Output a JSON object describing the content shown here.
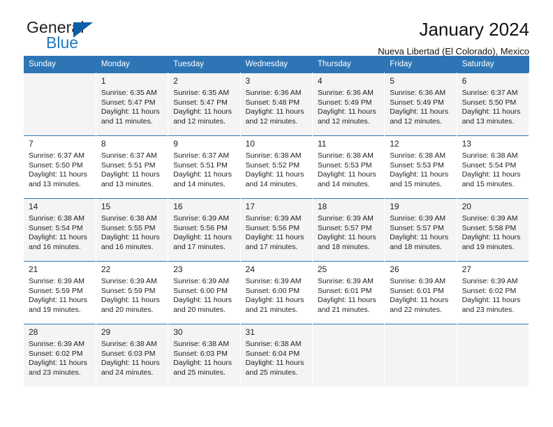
{
  "brand": {
    "name_top": "General",
    "name_bottom": "Blue",
    "triangle_color": "#0d5fa6",
    "blue_text_color": "#2179bf"
  },
  "header": {
    "title": "January 2024",
    "subtitle": "Nueva Libertad (El Colorado), Mexico"
  },
  "theme": {
    "header_bar_color": "#2e75b6",
    "shaded_row_color": "#f4f4f4",
    "text_color": "#222222"
  },
  "calendar": {
    "weekday_headers": [
      "Sunday",
      "Monday",
      "Tuesday",
      "Wednesday",
      "Thursday",
      "Friday",
      "Saturday"
    ],
    "weeks": [
      [
        {
          "day": "",
          "sunrise": "",
          "sunset": "",
          "daylight1": "",
          "daylight2": ""
        },
        {
          "day": "1",
          "sunrise": "Sunrise: 6:35 AM",
          "sunset": "Sunset: 5:47 PM",
          "daylight1": "Daylight: 11 hours",
          "daylight2": "and 11 minutes."
        },
        {
          "day": "2",
          "sunrise": "Sunrise: 6:35 AM",
          "sunset": "Sunset: 5:47 PM",
          "daylight1": "Daylight: 11 hours",
          "daylight2": "and 12 minutes."
        },
        {
          "day": "3",
          "sunrise": "Sunrise: 6:36 AM",
          "sunset": "Sunset: 5:48 PM",
          "daylight1": "Daylight: 11 hours",
          "daylight2": "and 12 minutes."
        },
        {
          "day": "4",
          "sunrise": "Sunrise: 6:36 AM",
          "sunset": "Sunset: 5:49 PM",
          "daylight1": "Daylight: 11 hours",
          "daylight2": "and 12 minutes."
        },
        {
          "day": "5",
          "sunrise": "Sunrise: 6:36 AM",
          "sunset": "Sunset: 5:49 PM",
          "daylight1": "Daylight: 11 hours",
          "daylight2": "and 12 minutes."
        },
        {
          "day": "6",
          "sunrise": "Sunrise: 6:37 AM",
          "sunset": "Sunset: 5:50 PM",
          "daylight1": "Daylight: 11 hours",
          "daylight2": "and 13 minutes."
        }
      ],
      [
        {
          "day": "7",
          "sunrise": "Sunrise: 6:37 AM",
          "sunset": "Sunset: 5:50 PM",
          "daylight1": "Daylight: 11 hours",
          "daylight2": "and 13 minutes."
        },
        {
          "day": "8",
          "sunrise": "Sunrise: 6:37 AM",
          "sunset": "Sunset: 5:51 PM",
          "daylight1": "Daylight: 11 hours",
          "daylight2": "and 13 minutes."
        },
        {
          "day": "9",
          "sunrise": "Sunrise: 6:37 AM",
          "sunset": "Sunset: 5:51 PM",
          "daylight1": "Daylight: 11 hours",
          "daylight2": "and 14 minutes."
        },
        {
          "day": "10",
          "sunrise": "Sunrise: 6:38 AM",
          "sunset": "Sunset: 5:52 PM",
          "daylight1": "Daylight: 11 hours",
          "daylight2": "and 14 minutes."
        },
        {
          "day": "11",
          "sunrise": "Sunrise: 6:38 AM",
          "sunset": "Sunset: 5:53 PM",
          "daylight1": "Daylight: 11 hours",
          "daylight2": "and 14 minutes."
        },
        {
          "day": "12",
          "sunrise": "Sunrise: 6:38 AM",
          "sunset": "Sunset: 5:53 PM",
          "daylight1": "Daylight: 11 hours",
          "daylight2": "and 15 minutes."
        },
        {
          "day": "13",
          "sunrise": "Sunrise: 6:38 AM",
          "sunset": "Sunset: 5:54 PM",
          "daylight1": "Daylight: 11 hours",
          "daylight2": "and 15 minutes."
        }
      ],
      [
        {
          "day": "14",
          "sunrise": "Sunrise: 6:38 AM",
          "sunset": "Sunset: 5:54 PM",
          "daylight1": "Daylight: 11 hours",
          "daylight2": "and 16 minutes."
        },
        {
          "day": "15",
          "sunrise": "Sunrise: 6:38 AM",
          "sunset": "Sunset: 5:55 PM",
          "daylight1": "Daylight: 11 hours",
          "daylight2": "and 16 minutes."
        },
        {
          "day": "16",
          "sunrise": "Sunrise: 6:39 AM",
          "sunset": "Sunset: 5:56 PM",
          "daylight1": "Daylight: 11 hours",
          "daylight2": "and 17 minutes."
        },
        {
          "day": "17",
          "sunrise": "Sunrise: 6:39 AM",
          "sunset": "Sunset: 5:56 PM",
          "daylight1": "Daylight: 11 hours",
          "daylight2": "and 17 minutes."
        },
        {
          "day": "18",
          "sunrise": "Sunrise: 6:39 AM",
          "sunset": "Sunset: 5:57 PM",
          "daylight1": "Daylight: 11 hours",
          "daylight2": "and 18 minutes."
        },
        {
          "day": "19",
          "sunrise": "Sunrise: 6:39 AM",
          "sunset": "Sunset: 5:57 PM",
          "daylight1": "Daylight: 11 hours",
          "daylight2": "and 18 minutes."
        },
        {
          "day": "20",
          "sunrise": "Sunrise: 6:39 AM",
          "sunset": "Sunset: 5:58 PM",
          "daylight1": "Daylight: 11 hours",
          "daylight2": "and 19 minutes."
        }
      ],
      [
        {
          "day": "21",
          "sunrise": "Sunrise: 6:39 AM",
          "sunset": "Sunset: 5:59 PM",
          "daylight1": "Daylight: 11 hours",
          "daylight2": "and 19 minutes."
        },
        {
          "day": "22",
          "sunrise": "Sunrise: 6:39 AM",
          "sunset": "Sunset: 5:59 PM",
          "daylight1": "Daylight: 11 hours",
          "daylight2": "and 20 minutes."
        },
        {
          "day": "23",
          "sunrise": "Sunrise: 6:39 AM",
          "sunset": "Sunset: 6:00 PM",
          "daylight1": "Daylight: 11 hours",
          "daylight2": "and 20 minutes."
        },
        {
          "day": "24",
          "sunrise": "Sunrise: 6:39 AM",
          "sunset": "Sunset: 6:00 PM",
          "daylight1": "Daylight: 11 hours",
          "daylight2": "and 21 minutes."
        },
        {
          "day": "25",
          "sunrise": "Sunrise: 6:39 AM",
          "sunset": "Sunset: 6:01 PM",
          "daylight1": "Daylight: 11 hours",
          "daylight2": "and 21 minutes."
        },
        {
          "day": "26",
          "sunrise": "Sunrise: 6:39 AM",
          "sunset": "Sunset: 6:01 PM",
          "daylight1": "Daylight: 11 hours",
          "daylight2": "and 22 minutes."
        },
        {
          "day": "27",
          "sunrise": "Sunrise: 6:39 AM",
          "sunset": "Sunset: 6:02 PM",
          "daylight1": "Daylight: 11 hours",
          "daylight2": "and 23 minutes."
        }
      ],
      [
        {
          "day": "28",
          "sunrise": "Sunrise: 6:39 AM",
          "sunset": "Sunset: 6:02 PM",
          "daylight1": "Daylight: 11 hours",
          "daylight2": "and 23 minutes."
        },
        {
          "day": "29",
          "sunrise": "Sunrise: 6:38 AM",
          "sunset": "Sunset: 6:03 PM",
          "daylight1": "Daylight: 11 hours",
          "daylight2": "and 24 minutes."
        },
        {
          "day": "30",
          "sunrise": "Sunrise: 6:38 AM",
          "sunset": "Sunset: 6:03 PM",
          "daylight1": "Daylight: 11 hours",
          "daylight2": "and 25 minutes."
        },
        {
          "day": "31",
          "sunrise": "Sunrise: 6:38 AM",
          "sunset": "Sunset: 6:04 PM",
          "daylight1": "Daylight: 11 hours",
          "daylight2": "and 25 minutes."
        },
        {
          "day": "",
          "sunrise": "",
          "sunset": "",
          "daylight1": "",
          "daylight2": ""
        },
        {
          "day": "",
          "sunrise": "",
          "sunset": "",
          "daylight1": "",
          "daylight2": ""
        },
        {
          "day": "",
          "sunrise": "",
          "sunset": "",
          "daylight1": "",
          "daylight2": ""
        }
      ]
    ]
  }
}
